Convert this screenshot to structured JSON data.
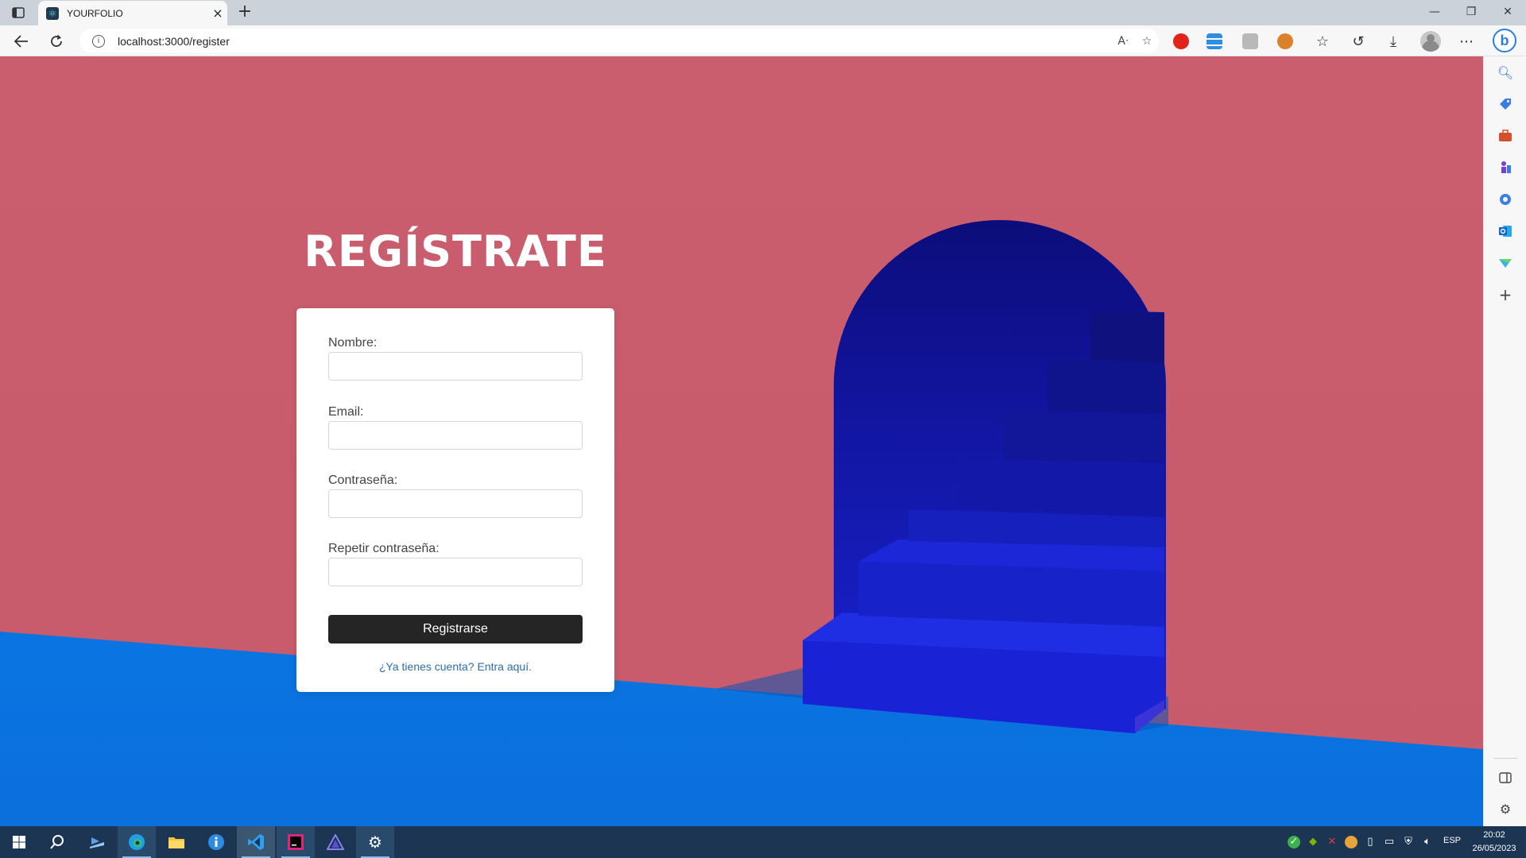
{
  "browser": {
    "tab": {
      "title": "YOURFOLIO",
      "favicon": "react-icon"
    },
    "url": "localhost:3000/register"
  },
  "page": {
    "heading": "REGÍSTRATE",
    "form": {
      "name_label": "Nombre:",
      "email_label": "Email:",
      "password_label": "Contraseña:",
      "repeat_password_label": "Repetir contraseña:",
      "name_value": "",
      "email_value": "",
      "password_value": "",
      "repeat_password_value": "",
      "submit_label": "Registrarse",
      "login_link": "¿Ya tienes cuenta? Entra aquí."
    }
  },
  "taskbar": {
    "language": "ESP",
    "time": "20:02",
    "date": "26/05/2023"
  },
  "colors": {
    "wall": "#c95d6d",
    "floor": "#0a73e0",
    "arch": "#1a1fc4",
    "button": "#252525",
    "link": "#2d6fa8",
    "taskbar": "#1b3553"
  }
}
